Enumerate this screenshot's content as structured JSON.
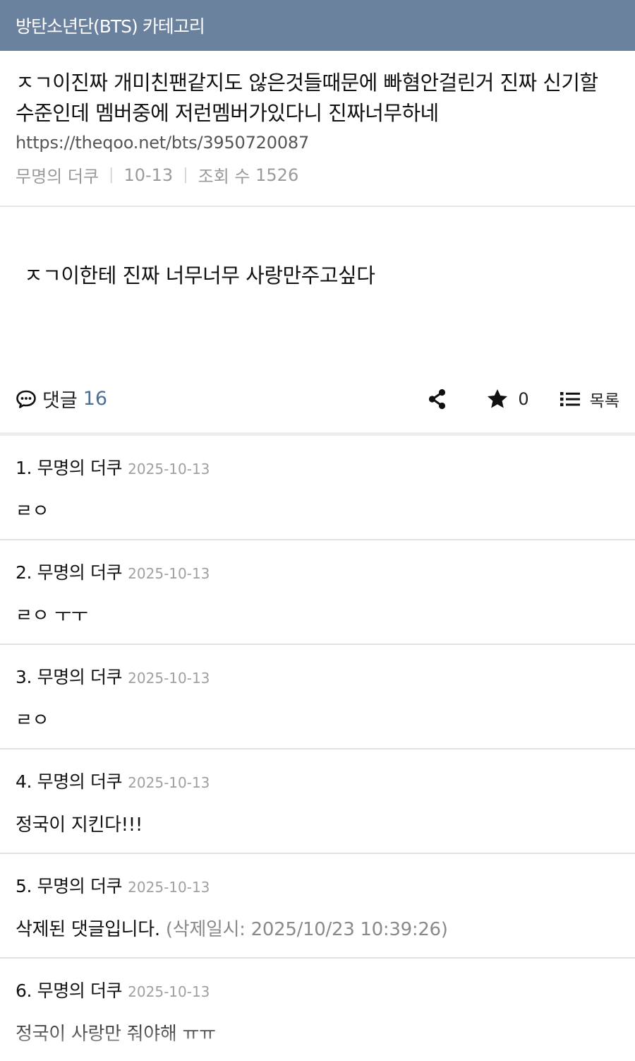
{
  "category": {
    "title": "방탄소년단(BTS) 카테고리"
  },
  "post": {
    "title": "ㅈㄱ이진짜 개미친팬같지도 않은것들때문에 빠혐안걸린거 진짜 신기할 수준인데 멤버중에 저런멤버가있다니 진짜너무하네",
    "url": "https://theqoo.net/bts/3950720087",
    "author": "무명의 더쿠",
    "date": "10-13",
    "views_label": "조회 수",
    "views": "1526",
    "body": "ㅈㄱ이한테 진짜 너무너무 사랑만주고싶다"
  },
  "actions": {
    "comment_label": "댓글",
    "comment_count": "16",
    "share_icon": "share-icon",
    "star_count": "0",
    "list_label": "목록"
  },
  "comments": [
    {
      "index": "1.",
      "author": "무명의 더쿠",
      "date": "2025-10-13",
      "text": "ㄹㅇ"
    },
    {
      "index": "2.",
      "author": "무명의 더쿠",
      "date": "2025-10-13",
      "text": "ㄹㅇ ㅜㅜ"
    },
    {
      "index": "3.",
      "author": "무명의 더쿠",
      "date": "2025-10-13",
      "text": "ㄹㅇ"
    },
    {
      "index": "4.",
      "author": "무명의 더쿠",
      "date": "2025-10-13",
      "text": "정국이 지킨다!!!"
    },
    {
      "index": "5.",
      "author": "무명의 더쿠",
      "date": "2025-10-13",
      "text": "삭제된 댓글입니다.",
      "note": "(삭제일시: 2025/10/23 10:39:26)"
    },
    {
      "index": "6.",
      "author": "무명의 더쿠",
      "date": "2025-10-13",
      "text": "정국이 사랑만 줘야해 ㅠㅠ"
    }
  ]
}
